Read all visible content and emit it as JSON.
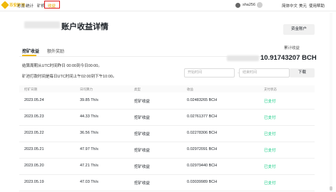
{
  "nav": {
    "brand": "币安矿池",
    "items": [
      "总览",
      "统计",
      "矿机",
      "收益"
    ],
    "username": "sha256",
    "right_items": [
      "简体中文",
      "美元",
      "使用帮助"
    ]
  },
  "page": {
    "title": "账户收益详情",
    "fund_button": "资金账户"
  },
  "tabs": [
    "挖矿收益",
    "额外奖励"
  ],
  "summary": {
    "total_label": "累计收益",
    "total_amount": "10.91743207 BCH"
  },
  "notes": [
    "结算周期从UTC时间昨日 00:00到今日00:00。",
    "矿池打款时间是每日UTC时间上午02:00到下午10:00。"
  ],
  "filter": {
    "start_placeholder": "开始时间",
    "arrow": "→",
    "end_placeholder": "结束时间",
    "download_button": "下载"
  },
  "table": {
    "headers": [
      "挖矿日期",
      "日均算力",
      "类型",
      "收益",
      "支付状态"
    ],
    "rows": [
      {
        "date": "2023.05.24",
        "hashrate": "39.85 Th/s",
        "type": "挖矿收益",
        "earnings": "0.02483265 BCH",
        "status": "已支付"
      },
      {
        "date": "2023.05.23",
        "hashrate": "44.33 Th/s",
        "type": "挖矿收益",
        "earnings": "0.02761377 BCH",
        "status": "已支付"
      },
      {
        "date": "2023.05.22",
        "hashrate": "36.56 Th/s",
        "type": "挖矿收益",
        "earnings": "0.02278306 BCH",
        "status": "已支付"
      },
      {
        "date": "2023.05.21",
        "hashrate": "47.97 Th/s",
        "type": "挖矿收益",
        "earnings": "0.02972091 BCH",
        "status": "已支付"
      },
      {
        "date": "2023.05.20",
        "hashrate": "47.21 Th/s",
        "type": "挖矿收益",
        "earnings": "0.02979440 BCH",
        "status": "已支付"
      },
      {
        "date": "2023.05.19",
        "hashrate": "47.03 Th/s",
        "type": "挖矿收益",
        "earnings": "0.03039989 BCH",
        "status": "已支付"
      }
    ]
  },
  "colors": {
    "accent": "#f0b90b",
    "paid": "#0ecb81",
    "highlight_box": "#e02020"
  }
}
